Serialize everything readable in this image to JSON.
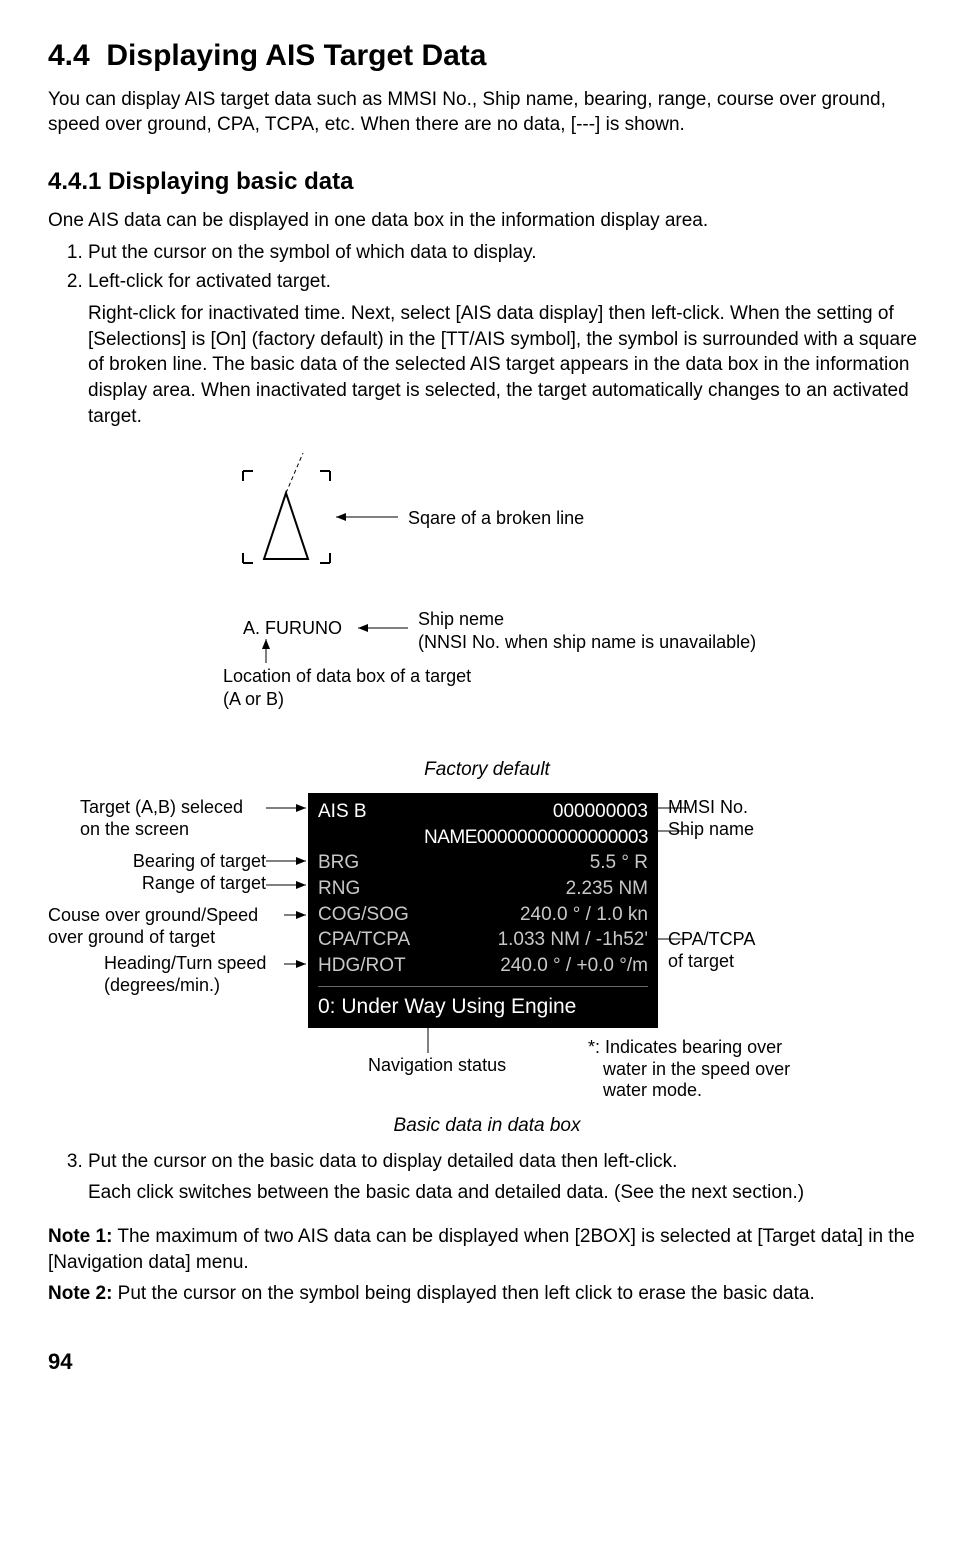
{
  "section": {
    "number": "4.4",
    "title": "Displaying AIS Target Data",
    "intro": "You can display AIS target data such as MMSI No., Ship name, bearing, range, course over ground, speed over ground, CPA, TCPA, etc. When there are no data, [---] is shown."
  },
  "subsection": {
    "number": "4.4.1",
    "title": "Displaying basic data",
    "lead": "One AIS data can be displayed in one data box in the information display area.",
    "step1": "Put the cursor on the symbol of which data to display.",
    "step2a": "Left-click for activated target.",
    "step2b": "Right-click for inactivated time. Next, select [AIS data display] then left-click. When the setting of [Selections] is [On] (factory default) in the [TT/AIS symbol], the symbol is surrounded with a square of broken line. The basic data of the selected AIS target appears in the data box in the information display area. When inactivated target is selected, the target automatically changes to an activated target.",
    "step3a": "Put the cursor on the basic data to display detailed data then left-click.",
    "step3b": "Each click switches between the basic data and detailed data. (See the next section.)"
  },
  "fig1": {
    "sqare_label": "Sqare of a broken line",
    "ship_label": "A. FURUNO",
    "ship_neme_l1": "Ship neme",
    "ship_neme_l2": "(NNSI No. when ship name is unavailable)",
    "loc_l1": "Location of data box of a target",
    "loc_l2": "(A or B)"
  },
  "fig2": {
    "caption_top": "Factory default",
    "caption_bottom": "Basic data in data box",
    "box": {
      "ais_label": "AIS B",
      "mmsi": "000000003",
      "name": "NAME00000000000000003",
      "brg_label": "BRG",
      "brg_val": "5.5 °  R",
      "rng_label": "RNG",
      "rng_val": "2.235 NM",
      "cogsog_label": "COG/SOG",
      "cogsog_val": "240.0 ° / 1.0 kn",
      "cpatcpa_label": "CPA/TCPA",
      "cpatcpa_val": "1.033 NM / -1h52'",
      "hdgrot_label": "HDG/ROT",
      "hdgrot_val": "240.0 ° / +0.0 °/m",
      "status": "0: Under Way Using Engine"
    },
    "ann": {
      "target_sel_l1": "Target (A,B) seleced",
      "target_sel_l2": "on the screen",
      "bearing": "Bearing of target",
      "range": "Range of target",
      "cogsog_l1": "Couse over ground/Speed",
      "cogsog_l2": "over ground of target",
      "hdgrot_l1": "Heading/Turn speed",
      "hdgrot_l2": "(degrees/min.)",
      "mmsi": "MMSI No.",
      "shipname": "Ship name",
      "cpatcpa_l1": "CPA/TCPA",
      "cpatcpa_l2": "of target",
      "navstatus": "Navigation status",
      "footnote_l1": "*: Indicates bearing over",
      "footnote_l2": "water in the speed over",
      "footnote_l3": "water mode."
    }
  },
  "notes": {
    "n1_label": "Note 1:",
    "n1_body": " The maximum of two AIS data can be displayed when [2BOX] is selected at [Target data] in the [Navigation data] menu.",
    "n2_label": "Note 2:",
    "n2_body": " Put the cursor on the symbol being displayed then left click to erase the basic data."
  },
  "page_number": "94"
}
